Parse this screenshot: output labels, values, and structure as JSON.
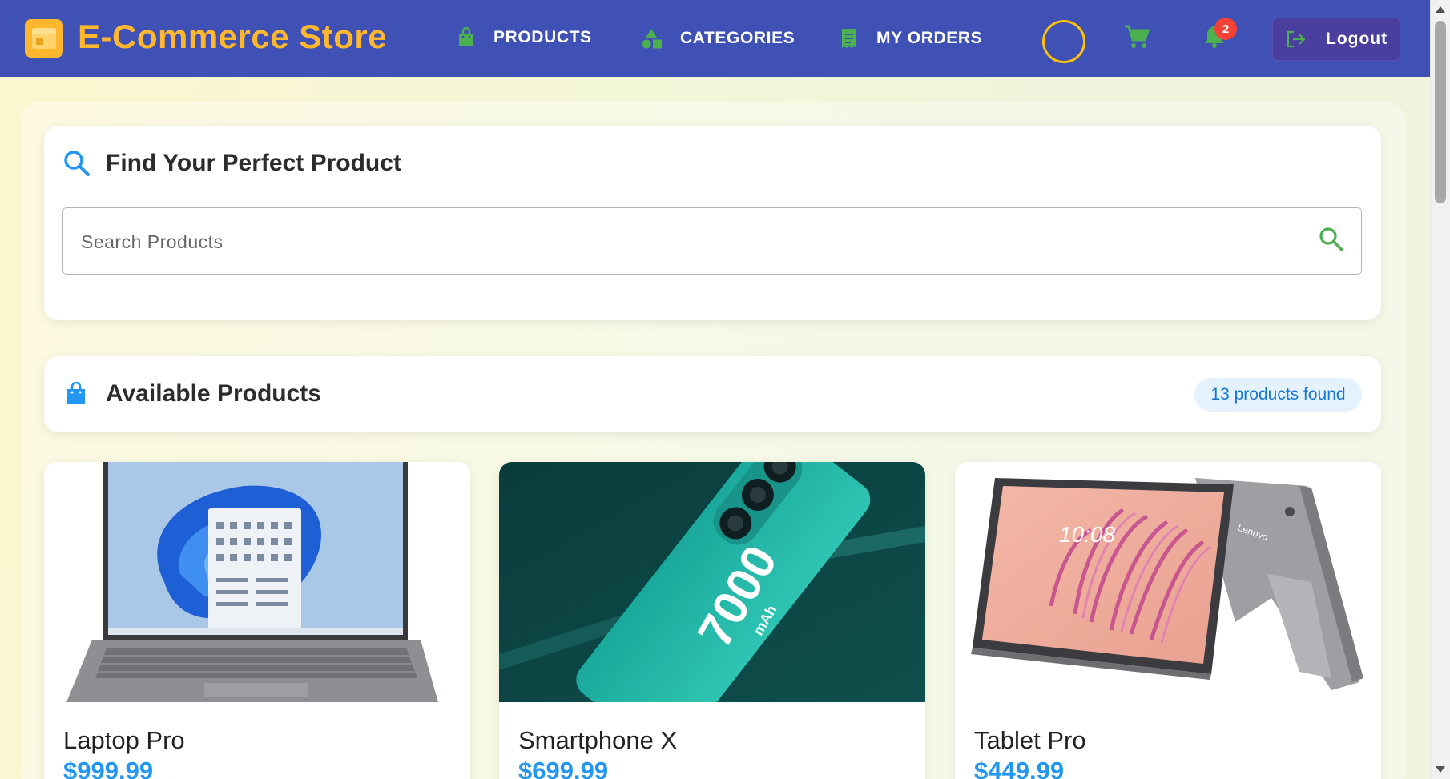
{
  "header": {
    "brand": "E-Commerce Store",
    "nav": [
      {
        "label": "PRODUCTS",
        "icon": "shopping-bag-icon"
      },
      {
        "label": "CATEGORIES",
        "icon": "category-shapes-icon"
      },
      {
        "label": "MY ORDERS",
        "icon": "receipt-icon"
      }
    ],
    "notification_count": "2",
    "logout_label": "Logout"
  },
  "search": {
    "title": "Find Your Perfect Product",
    "placeholder": "Search Products"
  },
  "products_section": {
    "title": "Available Products",
    "count_label": "13 products found"
  },
  "products": [
    {
      "name": "Laptop Pro",
      "price": "$999.99"
    },
    {
      "name": "Smartphone X",
      "price": "$699.99"
    },
    {
      "name": "Tablet Pro",
      "price": "$449.99"
    }
  ],
  "images": {
    "smartphone_text": "7000",
    "smartphone_unit": "mAh",
    "tablet_clock": "10:08",
    "tablet_brand": "Lenovo"
  },
  "colors": {
    "header_bg": "#3f51b5",
    "brand": "#ffb82e",
    "nav_icon": "#4caf50",
    "price": "#2196f3",
    "badge": "#f44336"
  }
}
